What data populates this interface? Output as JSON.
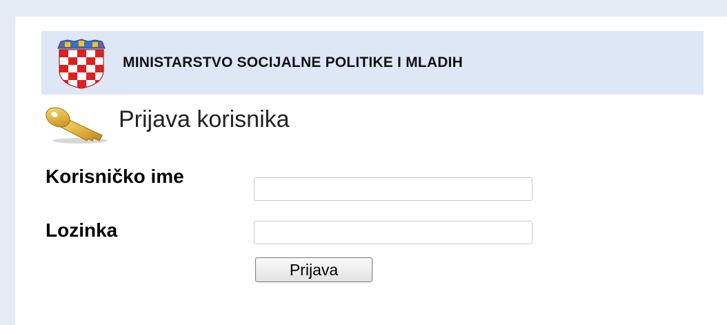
{
  "header": {
    "ministry_name": "MINISTARSTVO SOCIJALNE POLITIKE I MLADIH",
    "logo_icon": "croatian-coat-of-arms-icon",
    "banner_color": "#dde7f5"
  },
  "login": {
    "heading": "Prijava korisnika",
    "heading_icon": "key-icon",
    "username_label": "Korisničko ime",
    "username_value": "",
    "password_label": "Lozinka",
    "password_value": "",
    "submit_label": "Prijava"
  }
}
